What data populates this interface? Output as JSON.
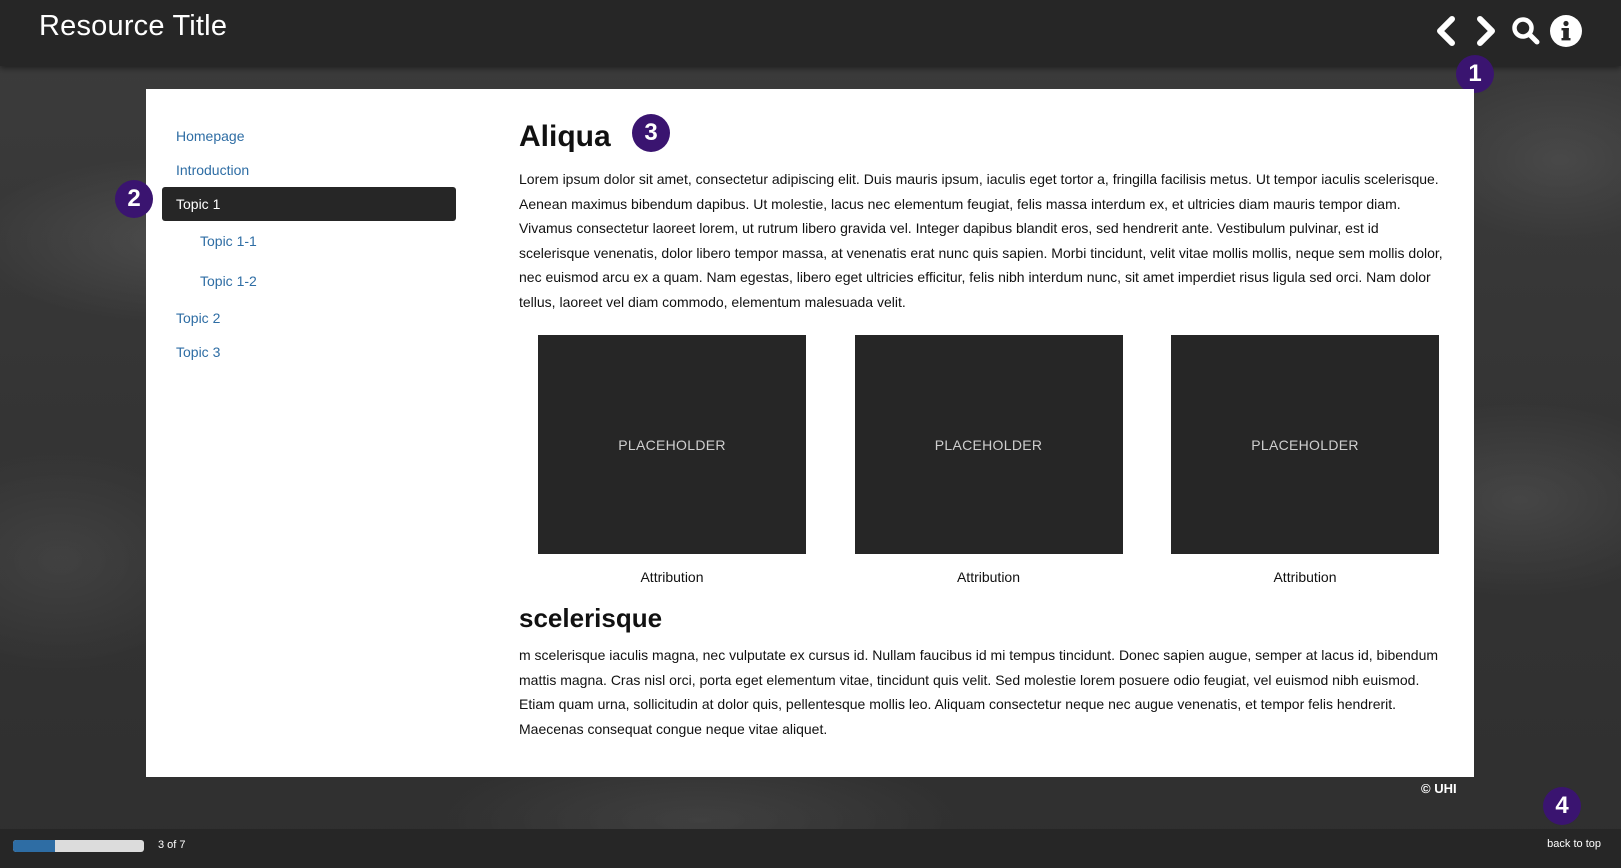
{
  "header": {
    "title": "Resource Title",
    "icons": [
      "chevron-left-icon",
      "chevron-right-icon",
      "search-icon",
      "info-icon"
    ]
  },
  "callouts": [
    "1",
    "2",
    "3",
    "4"
  ],
  "colors": {
    "topbar": "#262626",
    "callout": "#3a1470",
    "link": "#2e6da4",
    "active_nav": "#262626",
    "placeholder": "#262626"
  },
  "nav": {
    "items": [
      {
        "label": "Homepage"
      },
      {
        "label": "Introduction"
      },
      {
        "label": "Topic 1",
        "active": true
      },
      {
        "label": "Topic 1-1"
      },
      {
        "label": "Topic 1-2"
      },
      {
        "label": "Topic 2"
      },
      {
        "label": "Topic 3"
      }
    ]
  },
  "main": {
    "heading": "Aliqua",
    "paragraph1": "Lorem ipsum dolor sit amet, consectetur adipiscing elit. Duis mauris ipsum, iaculis eget tortor a, fringilla facilisis metus. Ut tempor iaculis scelerisque. Aenean maximus bibendum dapibus. Ut molestie, lacus nec elementum feugiat, felis massa interdum ex, et ultricies diam mauris tempor diam. Vivamus consectetur laoreet lorem, ut rutrum libero gravida vel. Integer dapibus blandit eros, sed hendrerit ante. Vestibulum pulvinar, est id scelerisque venenatis, dolor libero tempor massa, at venenatis erat nunc quis sapien. Morbi tincidunt, velit vitae mollis mollis, neque sem mollis dolor, nec euismod arcu ex a quam. Nam egestas, libero eget ultricies efficitur, felis nibh interdum nunc, sit amet imperdiet risus ligula sed orci. Nam dolor tellus, laoreet vel diam commodo, elementum malesuada velit.",
    "gallery": [
      {
        "placeholder": "PLACEHOLDER",
        "caption": "Attribution"
      },
      {
        "placeholder": "PLACEHOLDER",
        "caption": "Attribution"
      },
      {
        "placeholder": "PLACEHOLDER",
        "caption": "Attribution"
      }
    ],
    "subheading": "scelerisque",
    "paragraph2": "m scelerisque iaculis magna, nec vulputate ex cursus id. Nullam faucibus id mi tempus tincidunt. Donec sapien augue, semper at lacus id, bibendum mattis magna. Cras nisl orci, porta eget elementum vitae, tincidunt quis velit. Sed molestie lorem posuere odio feugiat, vel euismod nibh euismod. Etiam quam urna, sollicitudin at dolor quis, pellentesque mollis leo. Aliquam consectetur neque nec augue venenatis, et tempor felis hendrerit. Maecenas consequat congue neque vitae aliquet."
  },
  "footer": {
    "copyright": "© UHI",
    "page_count": "3 of 7",
    "progress_fraction": 0.32,
    "back_to_top": "back to top"
  }
}
